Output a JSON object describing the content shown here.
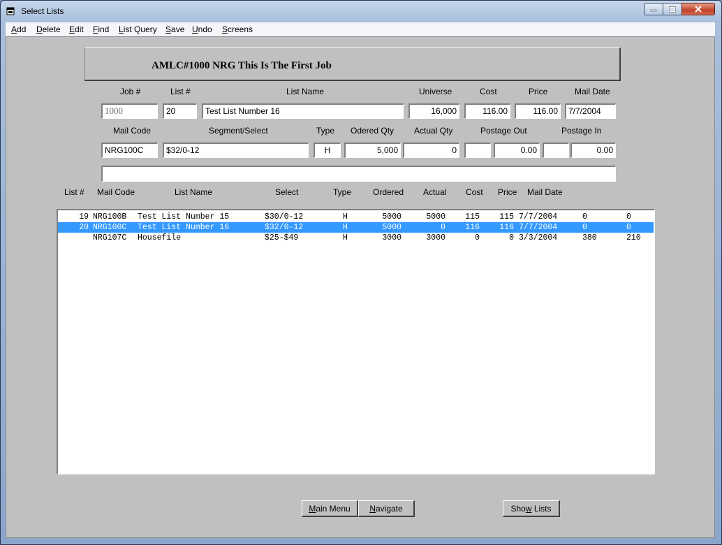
{
  "window": {
    "title": "Select Lists"
  },
  "menu": {
    "items": [
      {
        "accel": "A",
        "rest": "dd"
      },
      {
        "accel": "D",
        "rest": "elete"
      },
      {
        "accel": "E",
        "rest": "dit"
      },
      {
        "accel": "F",
        "rest": "ind"
      },
      {
        "accel": "L",
        "rest": "ist Query"
      },
      {
        "accel": "S",
        "rest": "ave"
      },
      {
        "accel": "U",
        "rest": "ndo"
      },
      {
        "accel": "S",
        "rest": "creens"
      }
    ]
  },
  "header": {
    "title": "AMLC#1000  NRG  This Is The First Job"
  },
  "form": {
    "labels": {
      "job": "Job #",
      "list": "List #",
      "list_name": "List Name",
      "universe": "Universe",
      "cost": "Cost",
      "price": "Price",
      "mail_date": "Mail Date",
      "mail_code": "Mail Code",
      "segment": "Segment/Select",
      "type": "Type",
      "ordered_qty": "Odered Qty",
      "actual_qty": "Actual Qty",
      "postage_out": "Postage Out",
      "postage_in": "Postage In"
    },
    "values": {
      "job": "1000",
      "list": "20",
      "list_name": "Test List Number 16",
      "universe": "16,000",
      "cost": "116.00",
      "price": "116.00",
      "mail_date": "7/7/2004",
      "mail_code": "NRG100C",
      "segment": "$32/0-12",
      "type": "H",
      "ordered_qty": "5,000",
      "actual_qty": "0",
      "postage_out_a": "",
      "postage_out": "0.00",
      "postage_in_a": "",
      "postage_in": "0.00",
      "notes": ""
    }
  },
  "grid": {
    "headers": {
      "list": "List #",
      "mail_code": "Mail Code",
      "list_name": "List Name",
      "select": "Select",
      "type": "Type",
      "ordered": "Ordered",
      "actual": "Actual",
      "cost": "Cost",
      "price": "Price",
      "mail_date": "Mail Date"
    },
    "rows": [
      {
        "list": "19",
        "mail_code": "NRG100B",
        "list_name": "Test List Number 15",
        "select": "$30/0-12",
        "type": "H",
        "ordered": "5000",
        "actual": "5000",
        "cost": "115",
        "price": "115",
        "mail_date": "7/7/2004",
        "post_out": "0",
        "post_in": "0"
      },
      {
        "list": "20",
        "mail_code": "NRG100C",
        "list_name": "Test List Number 16",
        "select": "$32/0-12",
        "type": "H",
        "ordered": "5000",
        "actual": "0",
        "cost": "116",
        "price": "116",
        "mail_date": "7/7/2004",
        "post_out": "0",
        "post_in": "0"
      },
      {
        "list": "",
        "mail_code": "NRG107C",
        "list_name": "Housefile",
        "select": "$25-$49",
        "type": "H",
        "ordered": "3000",
        "actual": "3000",
        "cost": "0",
        "price": "0",
        "mail_date": "3/3/2004",
        "post_out": "380",
        "post_in": "210"
      }
    ]
  },
  "buttons": {
    "main_menu": {
      "accel": "M",
      "rest": "ain Menu"
    },
    "navigate": {
      "accel": "N",
      "rest": "avigate"
    },
    "show_lists_pre": "Sho",
    "show_lists_accel": "w",
    "show_lists_rest": " Lists"
  },
  "colors": {
    "selection": "#3399ff",
    "client_bg": "#c0c0c0"
  }
}
